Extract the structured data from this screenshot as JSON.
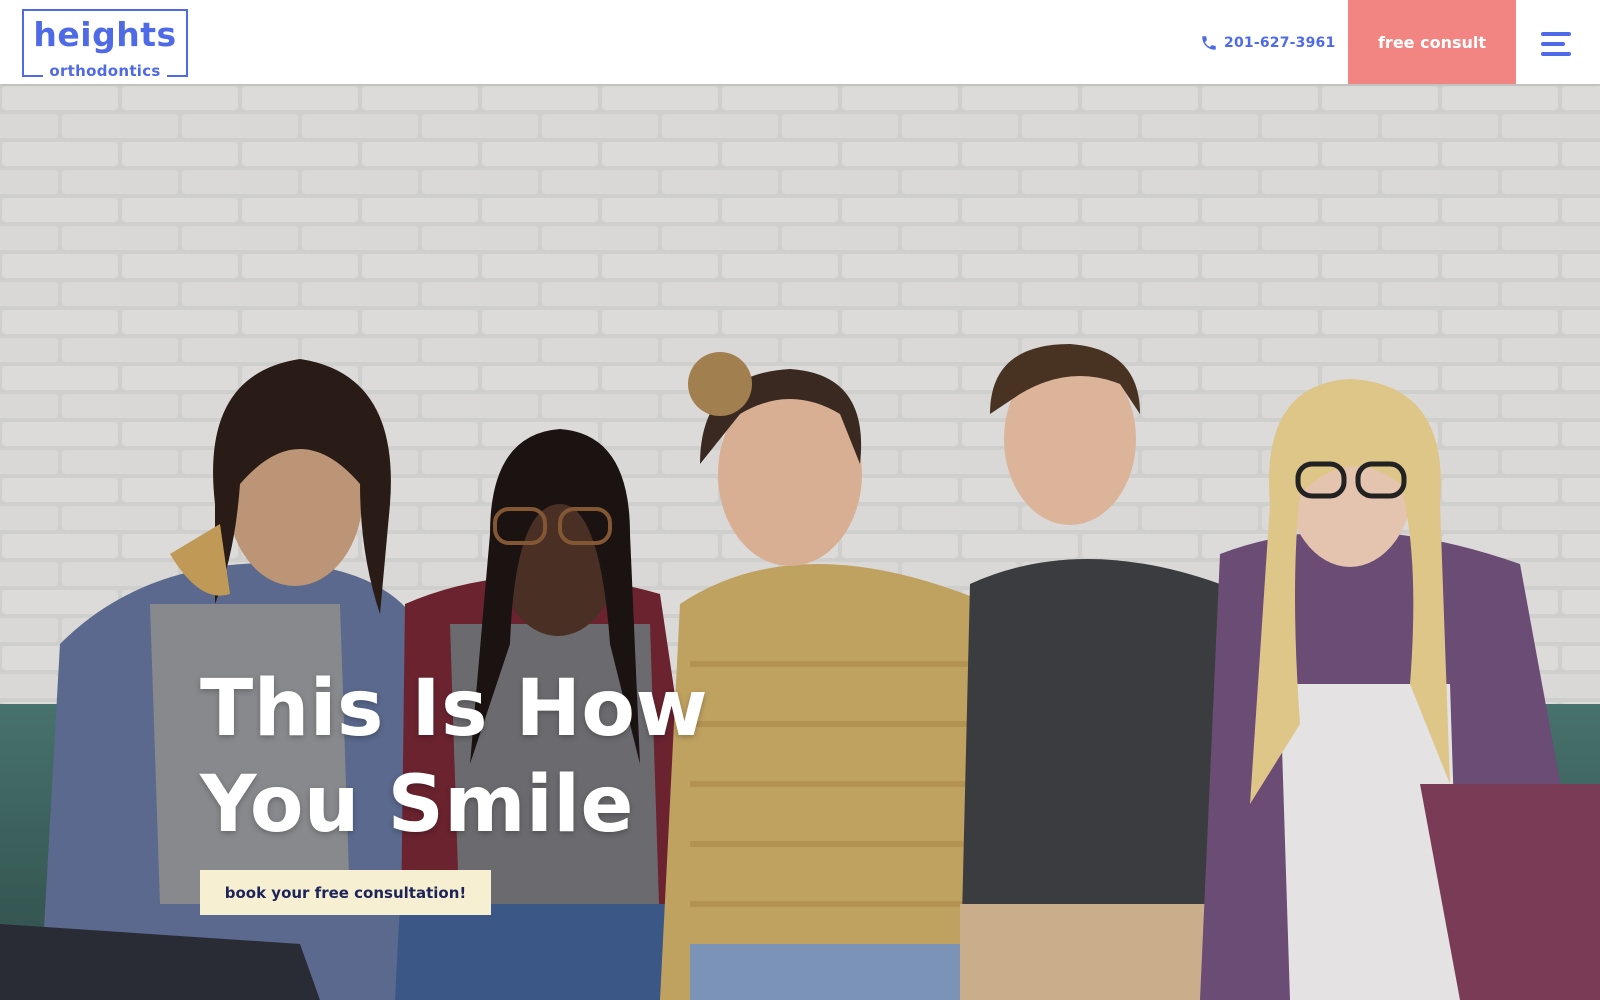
{
  "header": {
    "logo_main": "heights",
    "logo_sub": "orthodontics",
    "phone": "201-627-3961",
    "phone_icon": "phone-icon",
    "cta_label": "free consult",
    "menu_icon": "hamburger-menu-icon"
  },
  "hero": {
    "title_line1": "This Is How",
    "title_line2": "You Smile",
    "cta_label": "book your free consultation!",
    "image": "group-of-five-smiling-friends-on-couch"
  },
  "colors": {
    "brand_blue": "#4f6ae6",
    "cta_coral": "#f28582",
    "hero_button_cream": "#f7efd2",
    "hero_button_text": "#1c2459"
  }
}
